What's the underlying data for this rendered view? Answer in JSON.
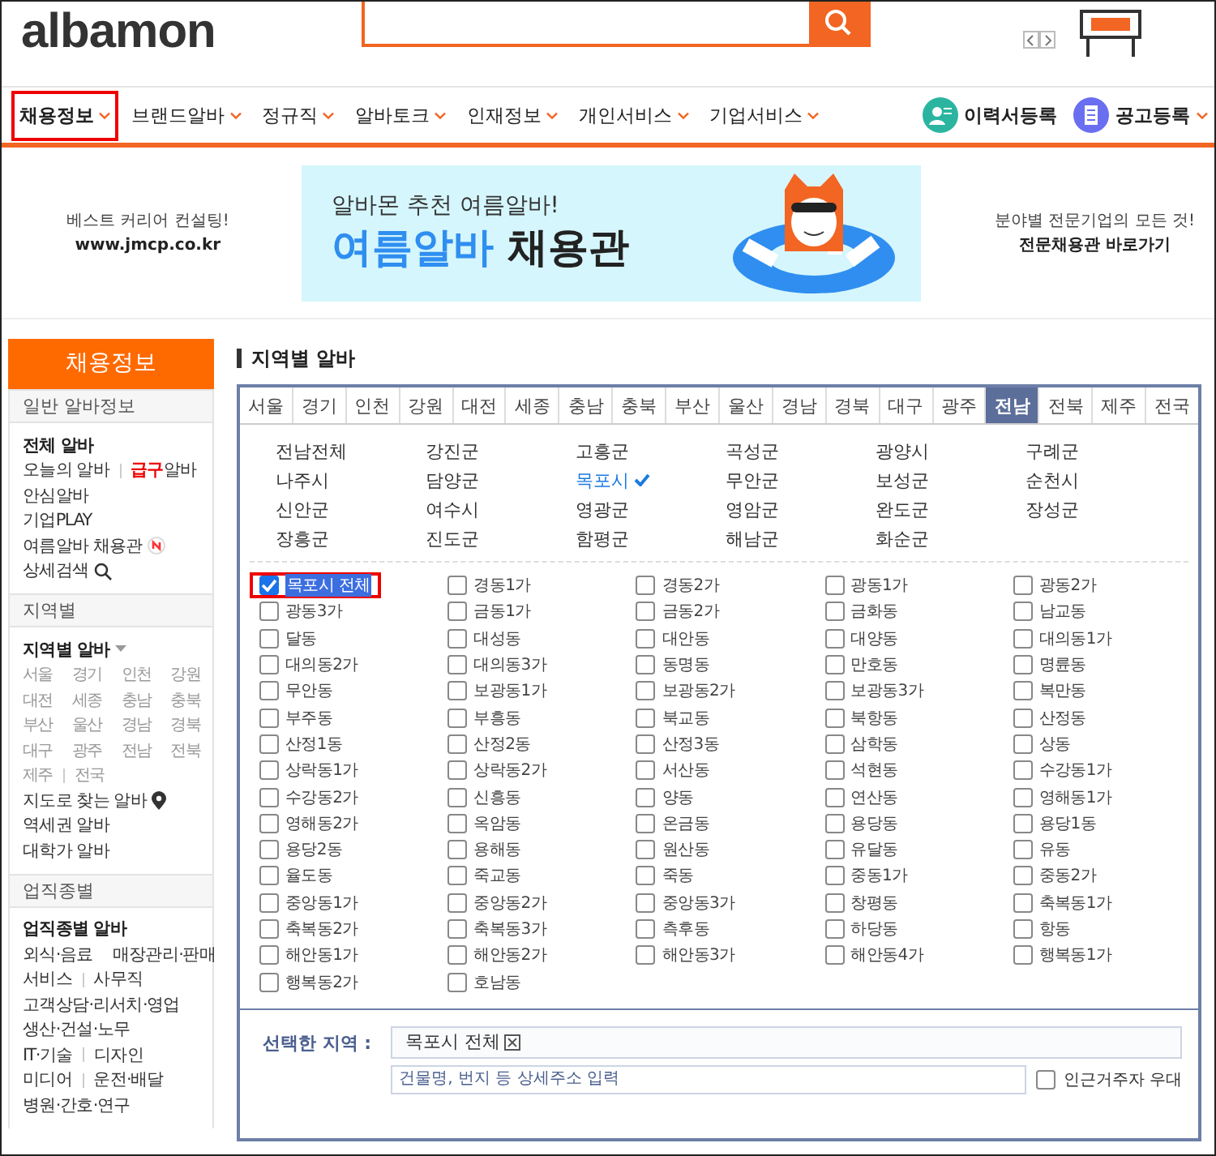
{
  "header": {
    "logo": "albamon"
  },
  "nav": {
    "items": [
      {
        "label": "채용정보",
        "selected": true,
        "highlighted": true
      },
      {
        "label": "브랜드알바",
        "selected": false,
        "highlighted": false
      },
      {
        "label": "정규직",
        "selected": false,
        "highlighted": false
      },
      {
        "label": "알바토크",
        "selected": false,
        "highlighted": false
      },
      {
        "label": "인재정보",
        "selected": false,
        "highlighted": false
      },
      {
        "label": "개인서비스",
        "selected": false,
        "highlighted": false
      },
      {
        "label": "기업서비스",
        "selected": false,
        "highlighted": false
      }
    ],
    "actions": [
      {
        "label": "이력서등록",
        "kind": "resume"
      },
      {
        "label": "공고등록",
        "kind": "post"
      }
    ]
  },
  "banner": {
    "left": {
      "line_1": "베스트 커리어 컨설팅!",
      "line_2": "www.jmcp.co.kr"
    },
    "ad": {
      "subtitle": "알바몬 추천 여름알바!",
      "highlight": "여름알바",
      "title": "채용관"
    },
    "right": {
      "line_1": "분야별 전문기업의 모든 것!",
      "line_2": "전문채용관 바로가기"
    }
  },
  "sidebar": {
    "title": "채용정보",
    "sections": [
      {
        "heading": "일반 알바정보",
        "lines": [
          [
            {
              "text": "전체 알바",
              "kind": "main"
            }
          ],
          [
            {
              "text": "오늘의 알바",
              "kind": "link"
            },
            {
              "text": "알바",
              "accent": "급구",
              "kind": "link"
            }
          ],
          [
            {
              "text": "안심알바",
              "kind": "link"
            }
          ],
          [
            {
              "text": "기업PLAY",
              "kind": "link"
            }
          ],
          [
            {
              "text": "여름알바 채용관",
              "kind": "new"
            }
          ],
          [
            {
              "text": "상세검색",
              "kind": "search"
            }
          ]
        ]
      },
      {
        "heading": "지역별",
        "lines": [
          [
            {
              "text": "지역별 알바",
              "kind": "dropdown"
            }
          ],
          [
            {
              "text": "서울",
              "kind": "region"
            },
            {
              "text": "경기",
              "kind": "region"
            },
            {
              "text": "인천",
              "kind": "region"
            },
            {
              "text": "강원",
              "kind": "region"
            }
          ],
          [
            {
              "text": "대전",
              "kind": "region"
            },
            {
              "text": "세종",
              "kind": "region"
            },
            {
              "text": "충남",
              "kind": "region"
            },
            {
              "text": "충북",
              "kind": "region"
            }
          ],
          [
            {
              "text": "부산",
              "kind": "region"
            },
            {
              "text": "울산",
              "kind": "region"
            },
            {
              "text": "경남",
              "kind": "region"
            },
            {
              "text": "경북",
              "kind": "region"
            }
          ],
          [
            {
              "text": "대구",
              "kind": "region"
            },
            {
              "text": "광주",
              "kind": "region"
            },
            {
              "text": "전남",
              "kind": "region"
            },
            {
              "text": "전북",
              "kind": "region"
            }
          ],
          [
            {
              "text": "제주",
              "kind": "region"
            },
            {
              "text": "전국",
              "kind": "region"
            }
          ],
          [
            {
              "text": "지도로 찾는 알바",
              "kind": "map"
            }
          ],
          [
            {
              "text": "역세권 알바",
              "kind": "link"
            }
          ],
          [
            {
              "text": "대학가 알바",
              "kind": "link"
            }
          ]
        ]
      },
      {
        "heading": "업직종별",
        "lines": [
          [
            {
              "text": "업직종별 알바",
              "kind": "main"
            }
          ],
          [
            {
              "text": "외식·음료",
              "kind": "link"
            },
            {
              "text": "매장관리·판매",
              "kind": "link"
            }
          ],
          [
            {
              "text": "서비스",
              "kind": "link"
            },
            {
              "text": "사무직",
              "kind": "link"
            }
          ],
          [
            {
              "text": "고객상담·리서치·영업",
              "kind": "link"
            }
          ],
          [
            {
              "text": "생산·건설·노무",
              "kind": "link"
            }
          ],
          [
            {
              "text": "IT·기술",
              "kind": "link"
            },
            {
              "text": "디자인",
              "kind": "link"
            }
          ],
          [
            {
              "text": "미디어",
              "kind": "link"
            },
            {
              "text": "운전·배달",
              "kind": "link"
            }
          ],
          [
            {
              "text": "병원·간호·연구",
              "kind": "link"
            }
          ]
        ]
      }
    ]
  },
  "main": {
    "title": "지역별 알바",
    "region_tabs": [
      {
        "label": "서울",
        "selected": false
      },
      {
        "label": "경기",
        "selected": false
      },
      {
        "label": "인천",
        "selected": false
      },
      {
        "label": "강원",
        "selected": false
      },
      {
        "label": "대전",
        "selected": false
      },
      {
        "label": "세종",
        "selected": false
      },
      {
        "label": "충남",
        "selected": false
      },
      {
        "label": "충북",
        "selected": false
      },
      {
        "label": "부산",
        "selected": false
      },
      {
        "label": "울산",
        "selected": false
      },
      {
        "label": "경남",
        "selected": false
      },
      {
        "label": "경북",
        "selected": false
      },
      {
        "label": "대구",
        "selected": false
      },
      {
        "label": "광주",
        "selected": false
      },
      {
        "label": "전남",
        "selected": true
      },
      {
        "label": "전북",
        "selected": false
      },
      {
        "label": "제주",
        "selected": false
      },
      {
        "label": "전국",
        "selected": false
      }
    ],
    "subregions": [
      {
        "label": "전남전체",
        "selected": false
      },
      {
        "label": "강진군",
        "selected": false
      },
      {
        "label": "고흥군",
        "selected": false
      },
      {
        "label": "곡성군",
        "selected": false
      },
      {
        "label": "광양시",
        "selected": false
      },
      {
        "label": "구례군",
        "selected": false
      },
      {
        "label": "나주시",
        "selected": false
      },
      {
        "label": "담양군",
        "selected": false
      },
      {
        "label": "목포시",
        "selected": true
      },
      {
        "label": "무안군",
        "selected": false
      },
      {
        "label": "보성군",
        "selected": false
      },
      {
        "label": "순천시",
        "selected": false
      },
      {
        "label": "신안군",
        "selected": false
      },
      {
        "label": "여수시",
        "selected": false
      },
      {
        "label": "영광군",
        "selected": false
      },
      {
        "label": "영암군",
        "selected": false
      },
      {
        "label": "완도군",
        "selected": false
      },
      {
        "label": "장성군",
        "selected": false
      },
      {
        "label": "장흥군",
        "selected": false
      },
      {
        "label": "진도군",
        "selected": false
      },
      {
        "label": "함평군",
        "selected": false
      },
      {
        "label": "해남군",
        "selected": false
      },
      {
        "label": "화순군",
        "selected": false
      }
    ],
    "dongs": [
      {
        "label": "목포시 전체",
        "checked": true,
        "highlighted": true
      },
      {
        "label": "경동1가",
        "checked": false,
        "highlighted": false
      },
      {
        "label": "경동2가",
        "checked": false,
        "highlighted": false
      },
      {
        "label": "광동1가",
        "checked": false,
        "highlighted": false
      },
      {
        "label": "광동2가",
        "checked": false,
        "highlighted": false
      },
      {
        "label": "광동3가",
        "checked": false,
        "highlighted": false
      },
      {
        "label": "금동1가",
        "checked": false,
        "highlighted": false
      },
      {
        "label": "금동2가",
        "checked": false,
        "highlighted": false
      },
      {
        "label": "금화동",
        "checked": false,
        "highlighted": false
      },
      {
        "label": "남교동",
        "checked": false,
        "highlighted": false
      },
      {
        "label": "달동",
        "checked": false,
        "highlighted": false
      },
      {
        "label": "대성동",
        "checked": false,
        "highlighted": false
      },
      {
        "label": "대안동",
        "checked": false,
        "highlighted": false
      },
      {
        "label": "대양동",
        "checked": false,
        "highlighted": false
      },
      {
        "label": "대의동1가",
        "checked": false,
        "highlighted": false
      },
      {
        "label": "대의동2가",
        "checked": false,
        "highlighted": false
      },
      {
        "label": "대의동3가",
        "checked": false,
        "highlighted": false
      },
      {
        "label": "동명동",
        "checked": false,
        "highlighted": false
      },
      {
        "label": "만호동",
        "checked": false,
        "highlighted": false
      },
      {
        "label": "명륜동",
        "checked": false,
        "highlighted": false
      },
      {
        "label": "무안동",
        "checked": false,
        "highlighted": false
      },
      {
        "label": "보광동1가",
        "checked": false,
        "highlighted": false
      },
      {
        "label": "보광동2가",
        "checked": false,
        "highlighted": false
      },
      {
        "label": "보광동3가",
        "checked": false,
        "highlighted": false
      },
      {
        "label": "복만동",
        "checked": false,
        "highlighted": false
      },
      {
        "label": "부주동",
        "checked": false,
        "highlighted": false
      },
      {
        "label": "부흥동",
        "checked": false,
        "highlighted": false
      },
      {
        "label": "북교동",
        "checked": false,
        "highlighted": false
      },
      {
        "label": "북항동",
        "checked": false,
        "highlighted": false
      },
      {
        "label": "산정동",
        "checked": false,
        "highlighted": false
      },
      {
        "label": "산정1동",
        "checked": false,
        "highlighted": false
      },
      {
        "label": "산정2동",
        "checked": false,
        "highlighted": false
      },
      {
        "label": "산정3동",
        "checked": false,
        "highlighted": false
      },
      {
        "label": "삼학동",
        "checked": false,
        "highlighted": false
      },
      {
        "label": "상동",
        "checked": false,
        "highlighted": false
      },
      {
        "label": "상락동1가",
        "checked": false,
        "highlighted": false
      },
      {
        "label": "상락동2가",
        "checked": false,
        "highlighted": false
      },
      {
        "label": "서산동",
        "checked": false,
        "highlighted": false
      },
      {
        "label": "석현동",
        "checked": false,
        "highlighted": false
      },
      {
        "label": "수강동1가",
        "checked": false,
        "highlighted": false
      },
      {
        "label": "수강동2가",
        "checked": false,
        "highlighted": false
      },
      {
        "label": "신흥동",
        "checked": false,
        "highlighted": false
      },
      {
        "label": "양동",
        "checked": false,
        "highlighted": false
      },
      {
        "label": "연산동",
        "checked": false,
        "highlighted": false
      },
      {
        "label": "영해동1가",
        "checked": false,
        "highlighted": false
      },
      {
        "label": "영해동2가",
        "checked": false,
        "highlighted": false
      },
      {
        "label": "옥암동",
        "checked": false,
        "highlighted": false
      },
      {
        "label": "온금동",
        "checked": false,
        "highlighted": false
      },
      {
        "label": "용당동",
        "checked": false,
        "highlighted": false
      },
      {
        "label": "용당1동",
        "checked": false,
        "highlighted": false
      },
      {
        "label": "용당2동",
        "checked": false,
        "highlighted": false
      },
      {
        "label": "용해동",
        "checked": false,
        "highlighted": false
      },
      {
        "label": "원산동",
        "checked": false,
        "highlighted": false
      },
      {
        "label": "유달동",
        "checked": false,
        "highlighted": false
      },
      {
        "label": "유동",
        "checked": false,
        "highlighted": false
      },
      {
        "label": "율도동",
        "checked": false,
        "highlighted": false
      },
      {
        "label": "죽교동",
        "checked": false,
        "highlighted": false
      },
      {
        "label": "죽동",
        "checked": false,
        "highlighted": false
      },
      {
        "label": "중동1가",
        "checked": false,
        "highlighted": false
      },
      {
        "label": "중동2가",
        "checked": false,
        "highlighted": false
      },
      {
        "label": "중앙동1가",
        "checked": false,
        "highlighted": false
      },
      {
        "label": "중앙동2가",
        "checked": false,
        "highlighted": false
      },
      {
        "label": "중앙동3가",
        "checked": false,
        "highlighted": false
      },
      {
        "label": "창평동",
        "checked": false,
        "highlighted": false
      },
      {
        "label": "축복동1가",
        "checked": false,
        "highlighted": false
      },
      {
        "label": "축복동2가",
        "checked": false,
        "highlighted": false
      },
      {
        "label": "축복동3가",
        "checked": false,
        "highlighted": false
      },
      {
        "label": "측후동",
        "checked": false,
        "highlighted": false
      },
      {
        "label": "하당동",
        "checked": false,
        "highlighted": false
      },
      {
        "label": "항동",
        "checked": false,
        "highlighted": false
      },
      {
        "label": "해안동1가",
        "checked": false,
        "highlighted": false
      },
      {
        "label": "해안동2가",
        "checked": false,
        "highlighted": false
      },
      {
        "label": "해안동3가",
        "checked": false,
        "highlighted": false
      },
      {
        "label": "해안동4가",
        "checked": false,
        "highlighted": false
      },
      {
        "label": "행복동1가",
        "checked": false,
        "highlighted": false
      },
      {
        "label": "행복동2가",
        "checked": false,
        "highlighted": false
      },
      {
        "label": "호남동",
        "checked": false,
        "highlighted": false
      }
    ],
    "selected_area": {
      "label": "선택한 지역 :",
      "chips": [
        "목포시 전체"
      ]
    },
    "address": {
      "placeholder": "건물명, 번지 등 상세주소 입력"
    },
    "nearby": {
      "label": "인근거주자 우대",
      "checked": false
    }
  }
}
